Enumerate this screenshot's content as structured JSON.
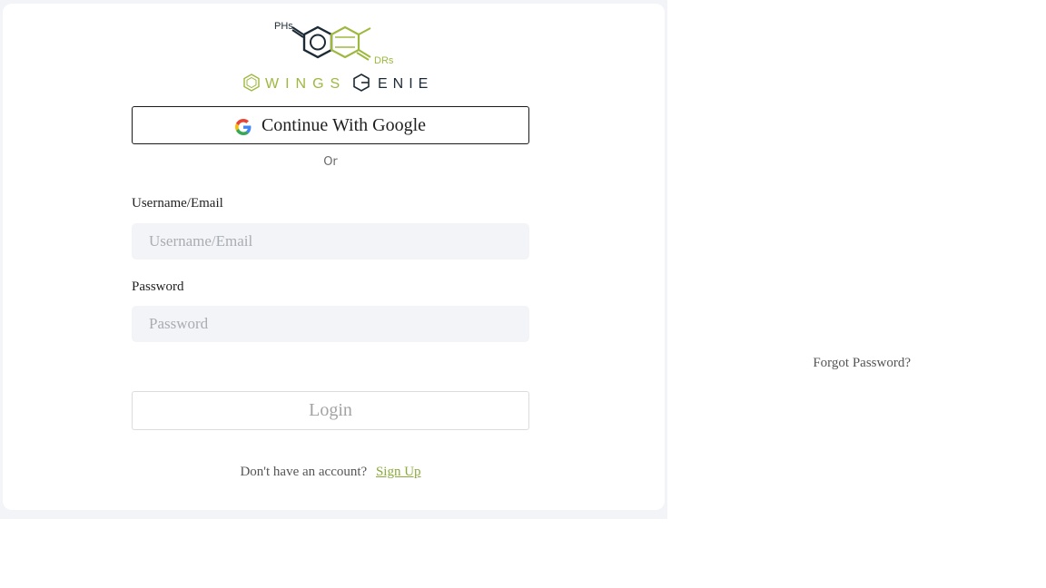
{
  "brand": {
    "molecule_label_top": "PHs",
    "molecule_label_bottom": "DRs",
    "word_left": "WINGS",
    "word_right": "ENIE",
    "colors": {
      "dark": "#1c2a35",
      "green": "#9db83e"
    }
  },
  "google_button": {
    "label": "Continue With Google",
    "icon": "google-g-icon"
  },
  "divider": {
    "text": "Or"
  },
  "username": {
    "label": "Username/Email",
    "placeholder": "Username/Email",
    "value": ""
  },
  "password": {
    "label": "Password",
    "placeholder": "Password",
    "value": ""
  },
  "forgot_password": {
    "label": "Forgot Password?"
  },
  "login_button": {
    "label": "Login"
  },
  "signup": {
    "question": "Don't have an account?",
    "link": "Sign Up"
  }
}
